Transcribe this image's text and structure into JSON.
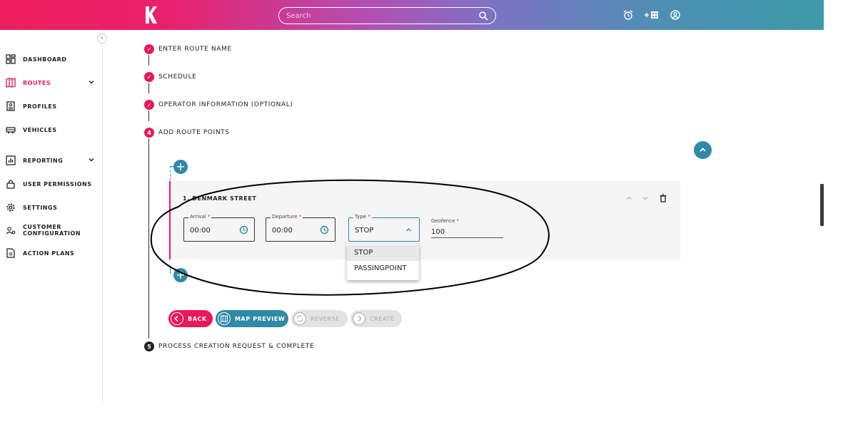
{
  "header": {
    "search": {
      "placeholder": "Search"
    },
    "icons": [
      "logo-icon",
      "search-icon",
      "alarm-clock-icon",
      "add-building-icon",
      "user-account-icon"
    ]
  },
  "sidebar": {
    "items": [
      {
        "label": "DASHBOARD",
        "icon": "dashboard-grid-icon"
      },
      {
        "label": "ROUTES",
        "icon": "map-icon",
        "active": true,
        "expandable": true
      },
      {
        "label": "PROFILES",
        "icon": "profile-card-icon"
      },
      {
        "label": "VEHICLES",
        "icon": "bus-icon"
      },
      {
        "label": "REPORTING",
        "icon": "bar-chart-icon",
        "expandable": true
      },
      {
        "label": "USER PERMISSIONS",
        "icon": "lock-icon"
      },
      {
        "label": "SETTINGS",
        "icon": "gear-icon"
      },
      {
        "label": "CUSTOMER\nCONFIGURATION",
        "label_lines": [
          "CUSTOMER",
          "CONFIGURATION"
        ],
        "icon": "people-settings-icon"
      },
      {
        "label": "ACTION PLANS",
        "icon": "document-icon"
      }
    ]
  },
  "stepper": {
    "steps": [
      {
        "marker": "check",
        "label": "ENTER ROUTE NAME"
      },
      {
        "marker": "check",
        "label": "SCHEDULE"
      },
      {
        "marker": "check",
        "label": "OPERATOR INFORMATION (OPTIONAL)"
      },
      {
        "marker": "4",
        "label": "ADD ROUTE POINTS"
      },
      {
        "marker": "5",
        "label": "PROCESS CREATION REQUEST & COMPLETE"
      }
    ]
  },
  "route_point": {
    "title": "1. DENMARK STREET",
    "arrival": {
      "label": "Arrival",
      "required": "*",
      "value": "00:00"
    },
    "departure": {
      "label": "Departure",
      "required": "*",
      "value": "00:00"
    },
    "type": {
      "label": "Type",
      "required": "*",
      "value": "STOP",
      "options": [
        "STOP",
        "PASSINGPOINT"
      ]
    },
    "geofence": {
      "label": "Geofence",
      "required": "*",
      "value": "100"
    }
  },
  "actions": {
    "back": "BACK",
    "map_preview": "MAP PREVIEW",
    "reverse": "REVERSE",
    "create": "CREATE"
  },
  "colors": {
    "accent": "#e8195a",
    "teal": "#2e8aa6",
    "disabled": "#e3e3e3"
  }
}
